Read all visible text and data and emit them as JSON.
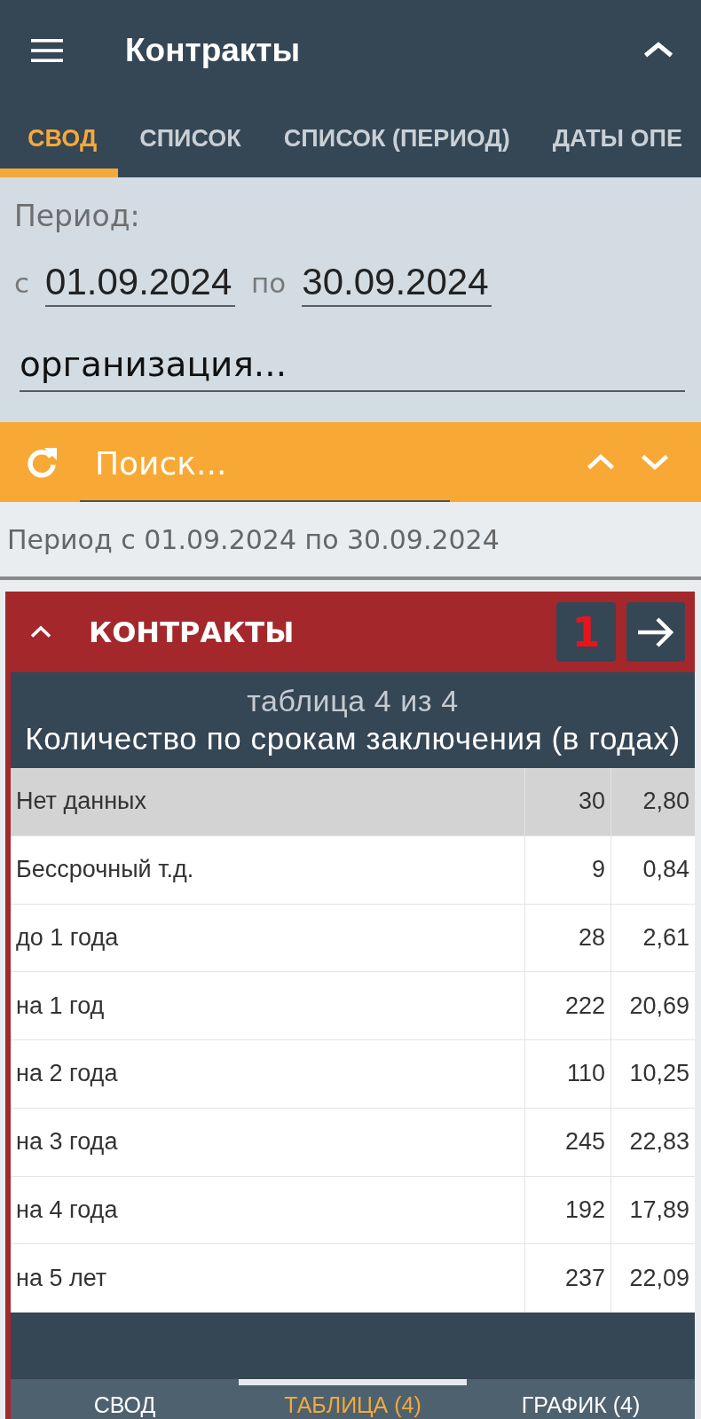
{
  "app_bar": {
    "title": "Контракты"
  },
  "tabs": [
    {
      "label": "СВОД",
      "selected": true
    },
    {
      "label": "СПИСОК",
      "selected": false
    },
    {
      "label": "СПИСОК (ПЕРИОД)",
      "selected": false
    },
    {
      "label": "ДАТЫ ОПЕ",
      "selected": false
    }
  ],
  "filter": {
    "period_label": "Период:",
    "from_label": "с",
    "from_date": "01.09.2024",
    "to_label": "по",
    "to_date": "30.09.2024",
    "organization": {
      "placeholder": "организация..."
    }
  },
  "search": {
    "placeholder": "Поиск..."
  },
  "period_summary": "Период с 01.09.2024 по 30.09.2024",
  "panel": {
    "title": "КОНТРАКТЫ",
    "expanded": true,
    "badge": "1",
    "table_caption": "таблица 4 из 4",
    "table_title": "Количество по срокам заключения (в годах)",
    "rows": [
      {
        "label": "Нет данных",
        "count": "30",
        "percent": "2,80",
        "selected": true
      },
      {
        "label": "Бессрочный т.д.",
        "count": "9",
        "percent": "0,84",
        "selected": false
      },
      {
        "label": "до 1 года",
        "count": "28",
        "percent": "2,61",
        "selected": false
      },
      {
        "label": "на 1 год",
        "count": "222",
        "percent": "20,69",
        "selected": false
      },
      {
        "label": "на 2 года",
        "count": "110",
        "percent": "10,25",
        "selected": false
      },
      {
        "label": "на 3 года",
        "count": "245",
        "percent": "22,83",
        "selected": false
      },
      {
        "label": "на 4 года",
        "count": "192",
        "percent": "17,89",
        "selected": false
      },
      {
        "label": "на 5 лет",
        "count": "237",
        "percent": "22,09",
        "selected": false
      }
    ]
  },
  "bottom_tabs": [
    {
      "label": "СВОД",
      "selected": false
    },
    {
      "label": "ТАБЛИЦА (4)",
      "selected": true
    },
    {
      "label": "ГРАФИК (4)",
      "selected": false
    }
  ]
}
